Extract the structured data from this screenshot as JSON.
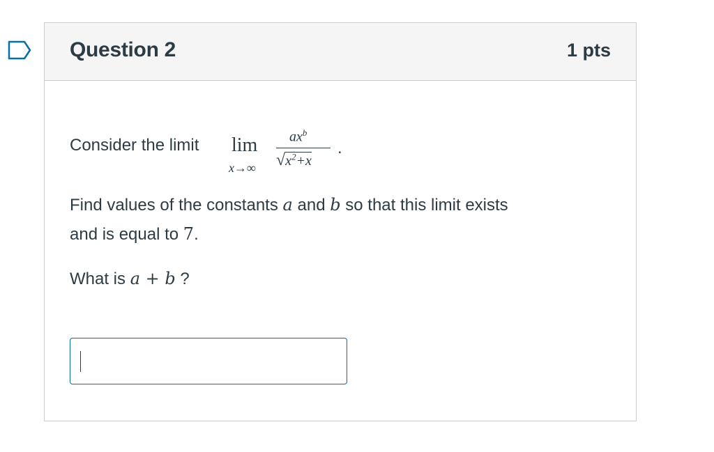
{
  "question": {
    "title": "Question 2",
    "points": "1 pts",
    "limit_intro": "Consider the limit",
    "limit_word": "lim",
    "limit_sub": "x→∞",
    "numerator_base": "ax",
    "numerator_exp": "b",
    "denominator_radical": "√",
    "denominator_base": "x",
    "denominator_exp": "2",
    "denominator_tail": "+x",
    "period": ".",
    "line2_part1": "Find values of the constants",
    "var_a": "a",
    "word_and": "and",
    "var_b": "b",
    "line2_part2": "so that this limit exists",
    "line3_part1": "and is equal to",
    "value_7": "7",
    "line3_end": ".",
    "line4_part1": "What is",
    "expr_sum": "a + b",
    "line4_end": "?"
  },
  "answer": {
    "value": "",
    "placeholder": ""
  },
  "colors": {
    "text": "#2d3b45",
    "header_bg": "#f5f5f5",
    "border": "#c7cdd1",
    "input_border": "#0770a3",
    "flag": "#0770a3"
  }
}
